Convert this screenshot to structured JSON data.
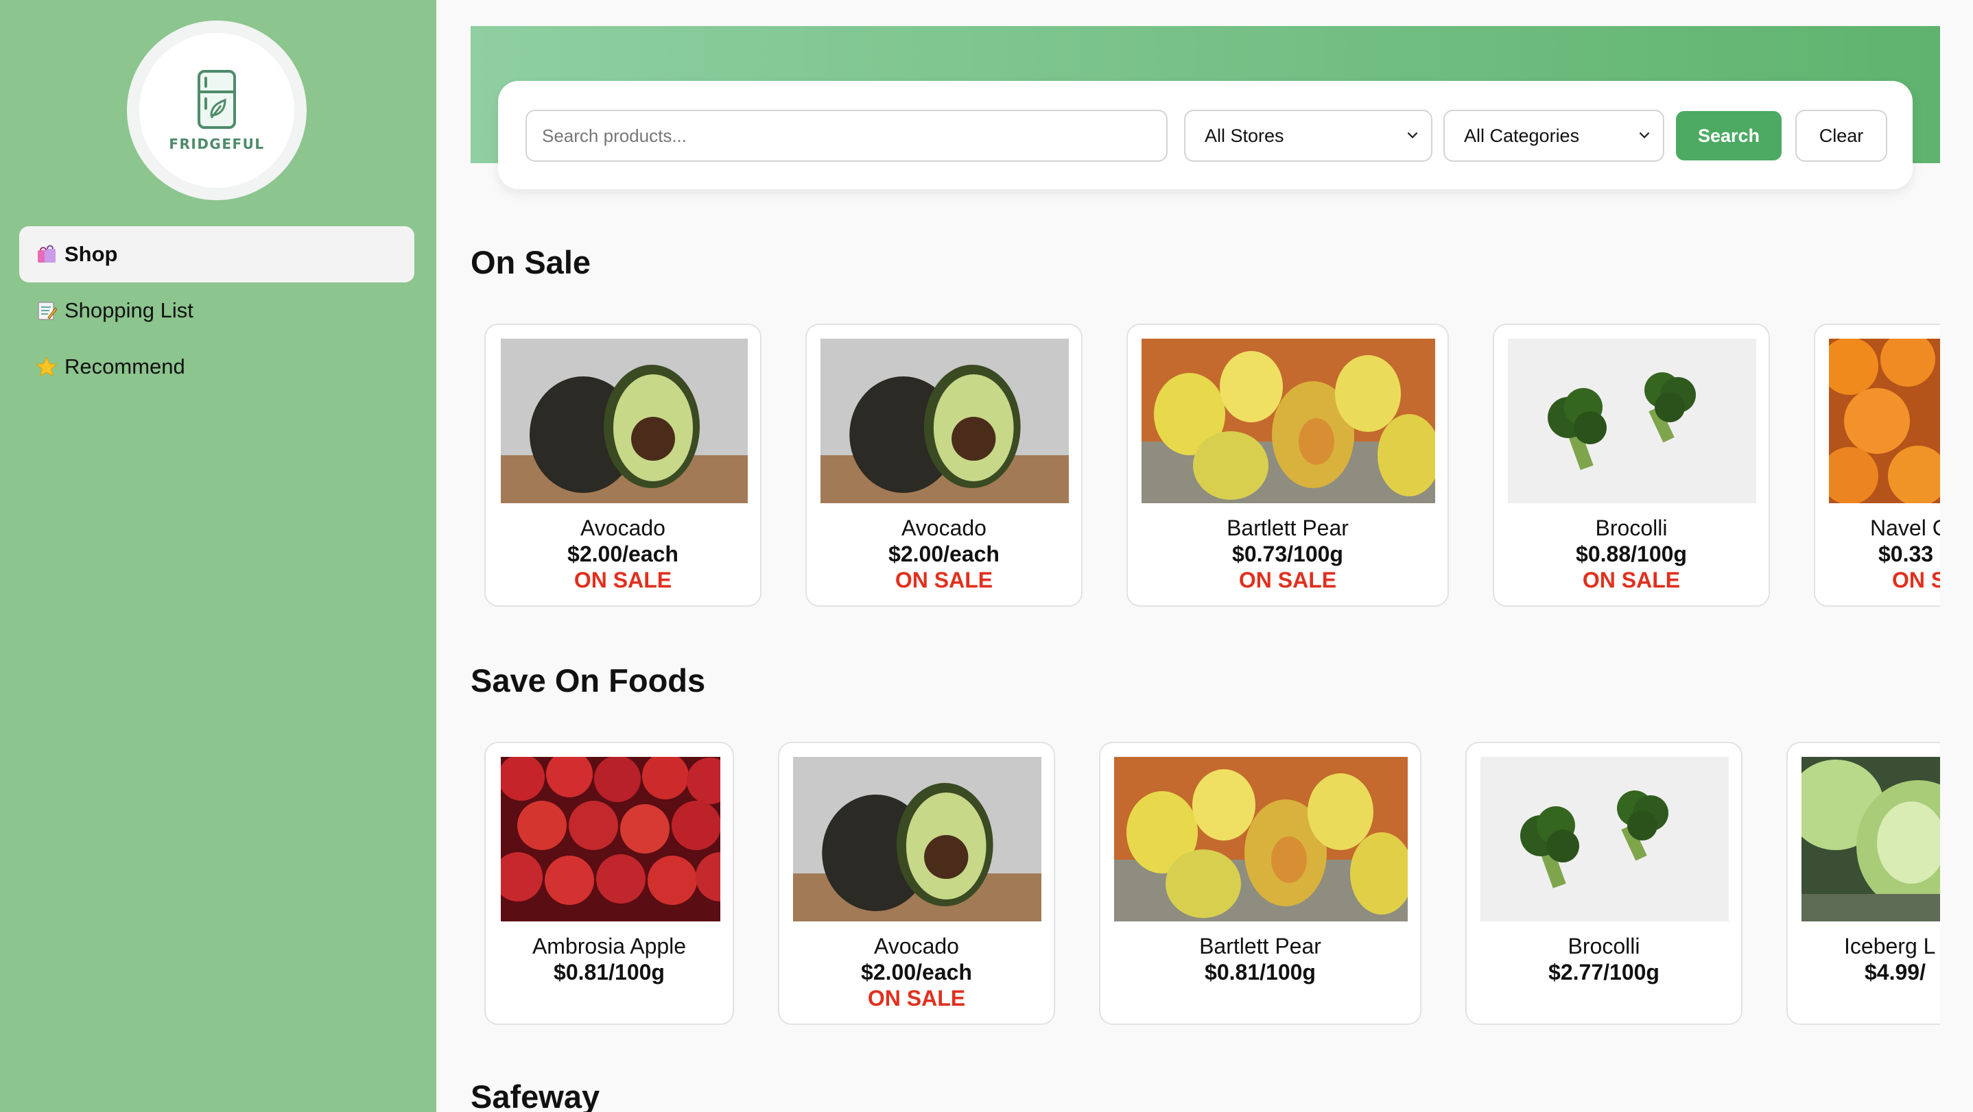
{
  "sidebar": {
    "logo_text": "FRIDGEFUL",
    "items": [
      {
        "label": "Shop",
        "icon": "shopping-bags-icon",
        "active": true
      },
      {
        "label": "Shopping List",
        "icon": "memo-icon",
        "active": false
      },
      {
        "label": "Recommend",
        "icon": "star-icon",
        "active": false
      }
    ]
  },
  "search": {
    "placeholder": "Search products...",
    "store_select": "All Stores",
    "category_select": "All Categories",
    "search_label": "Search",
    "clear_label": "Clear"
  },
  "sections": [
    {
      "title": "On Sale",
      "products": [
        {
          "name": "Avocado",
          "price": "$2.00/each",
          "badge": "ON SALE",
          "image": "avocado"
        },
        {
          "name": "Avocado",
          "price": "$2.00/each",
          "badge": "ON SALE",
          "image": "avocado"
        },
        {
          "name": "Bartlett Pear",
          "price": "$0.73/100g",
          "badge": "ON SALE",
          "image": "pear"
        },
        {
          "name": "Brocolli",
          "price": "$0.88/100g",
          "badge": "ON SALE",
          "image": "broccoli"
        },
        {
          "name": "Navel C",
          "price": "$0.33",
          "badge": "ON S",
          "image": "orange"
        }
      ]
    },
    {
      "title": "Save On Foods",
      "products": [
        {
          "name": "Ambrosia Apple",
          "price": "$0.81/100g",
          "badge": "",
          "image": "apple"
        },
        {
          "name": "Avocado",
          "price": "$2.00/each",
          "badge": "ON SALE",
          "image": "avocado"
        },
        {
          "name": "Bartlett Pear",
          "price": "$0.81/100g",
          "badge": "",
          "image": "pear"
        },
        {
          "name": "Brocolli",
          "price": "$2.77/100g",
          "badge": "",
          "image": "broccoli"
        },
        {
          "name": "Iceberg L",
          "price": "$4.99/",
          "badge": "",
          "image": "lettuce"
        }
      ]
    },
    {
      "title": "Safeway",
      "products": []
    }
  ],
  "colors": {
    "sidebar_bg": "#8cc58e",
    "accent": "#4caa63",
    "sale_red": "#e0301e"
  }
}
